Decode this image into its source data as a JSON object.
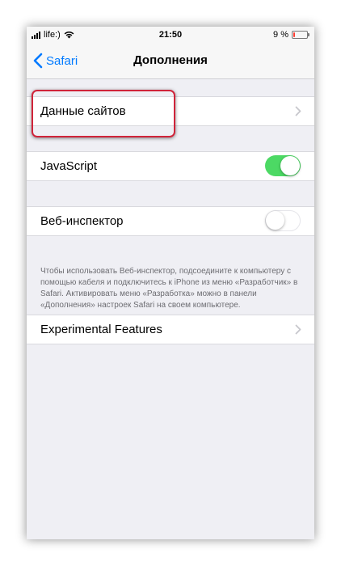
{
  "status_bar": {
    "carrier": "life:)",
    "time": "21:50",
    "battery_percent": "9 %",
    "battery_level": 0.09,
    "battery_color": "#ff3b30"
  },
  "nav": {
    "back_label": "Safari",
    "back_icon": "chevron-left-icon",
    "title": "Дополнения"
  },
  "rows": {
    "site_data": {
      "label": "Данные сайтов",
      "accessory": "chevron-right-icon"
    },
    "javascript": {
      "label": "JavaScript",
      "enabled": true
    },
    "web_inspector": {
      "label": "Веб-инспектор",
      "enabled": false,
      "note": "Чтобы использовать Веб-инспектор, подсоедините к компьютеру с помощью кабеля и подключитесь к iPhone из меню «Разработчик» в Safari. Активировать меню «Разработка» можно в панели «Дополнения» настроек Safari на своем компьютере."
    },
    "experimental": {
      "label": "Experimental Features",
      "accessory": "chevron-right-icon"
    }
  },
  "colors": {
    "accent": "#007aff",
    "toggle_on": "#4cd964",
    "highlight_border": "#d0243a",
    "background": "#efeff4"
  }
}
